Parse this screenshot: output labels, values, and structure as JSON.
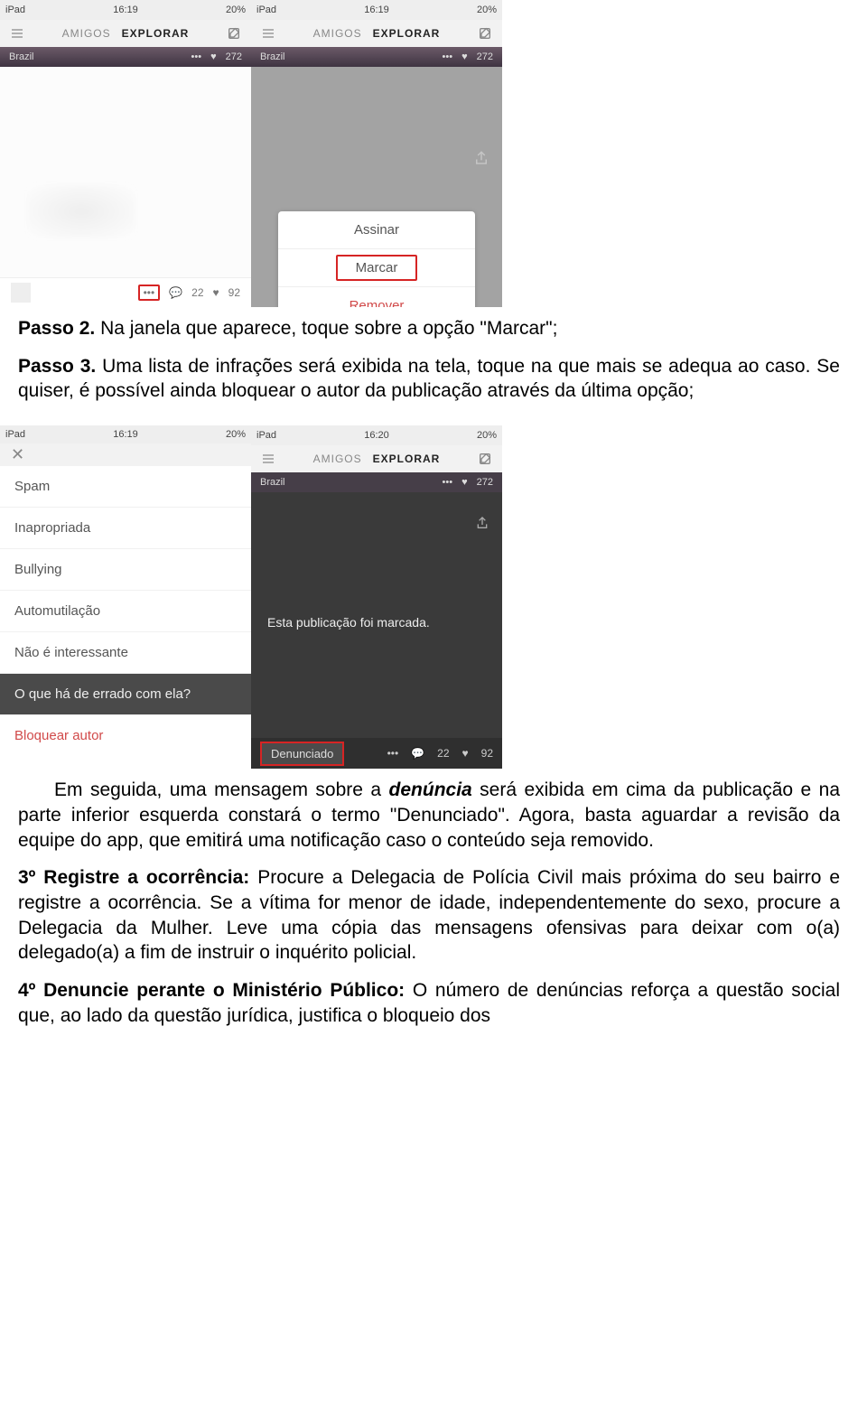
{
  "row1": {
    "left": {
      "status": {
        "device": "iPad",
        "wifi": "᛭",
        "time": "16:19",
        "loc": "⌖",
        "battery": "20%"
      },
      "nav": {
        "amigos": "AMIGOS",
        "explorar": "EXPLORAR"
      },
      "post": {
        "country": "Brazil",
        "views": "272"
      },
      "footer": {
        "comments": "22",
        "likes": "92"
      }
    },
    "right": {
      "status": {
        "device": "iPad",
        "time": "16:19",
        "battery": "20%"
      },
      "nav": {
        "amigos": "AMIGOS",
        "explorar": "EXPLORAR"
      },
      "post": {
        "country": "Brazil",
        "views": "272"
      },
      "menu": {
        "assinar": "Assinar",
        "marcar": "Marcar",
        "remover": "Remover"
      }
    }
  },
  "text1": {
    "p1a": "Passo 2.",
    "p1b": " Na janela que aparece, toque sobre a opção \"Marcar\";",
    "p2a": "Passo 3.",
    "p2b": " Uma lista de infrações será exibida na tela, toque na que mais se adequa ao caso.",
    "p3": " Se quiser, é possível ainda bloquear o autor da publicação através da última opção;"
  },
  "row2": {
    "left": {
      "status": {
        "device": "iPad",
        "time": "16:19",
        "battery": "20%"
      },
      "items": {
        "spam": "Spam",
        "inap": "Inapropriada",
        "bully": "Bullying",
        "auto": "Automutilação",
        "nao": "Não é interessante",
        "oque": "O que há de errado com ela?"
      },
      "block": "Bloquear autor"
    },
    "right": {
      "status": {
        "device": "iPad",
        "time": "16:20",
        "battery": "20%"
      },
      "nav": {
        "amigos": "AMIGOS",
        "explorar": "EXPLORAR"
      },
      "post": {
        "country": "Brazil",
        "views": "272"
      },
      "msg": "Esta publicação foi marcada.",
      "footer": {
        "badge": "Denunciado",
        "comments": "22",
        "likes": "92"
      }
    }
  },
  "text2": {
    "p1a": "Em seguida, uma mensagem sobre a ",
    "p1b": "denúncia",
    "p1c": " será exibida em cima da publicação e na parte inferior esquerda constará o termo \"Denunciado\". Agora, basta aguardar a revisão da equipe do app, que emitirá uma notificação caso o conteúdo seja removido.",
    "p2a": "3º Registre a ocorrência:",
    "p2b": " Procure a Delegacia de Polícia Civil mais próxima do seu bairro e registre a ocorrência. Se a vítima for menor de idade, independentemente do sexo, procure a Delegacia da Mulher. Leve uma cópia das mensagens ofensivas para deixar com o(a) delegado(a) a fim de instruir o inquérito policial.",
    "p3a": "4º Denuncie perante o Ministério Público:",
    "p3b": " O número de denúncias reforça a questão social que, ao lado da questão jurídica, justifica o bloqueio dos"
  }
}
